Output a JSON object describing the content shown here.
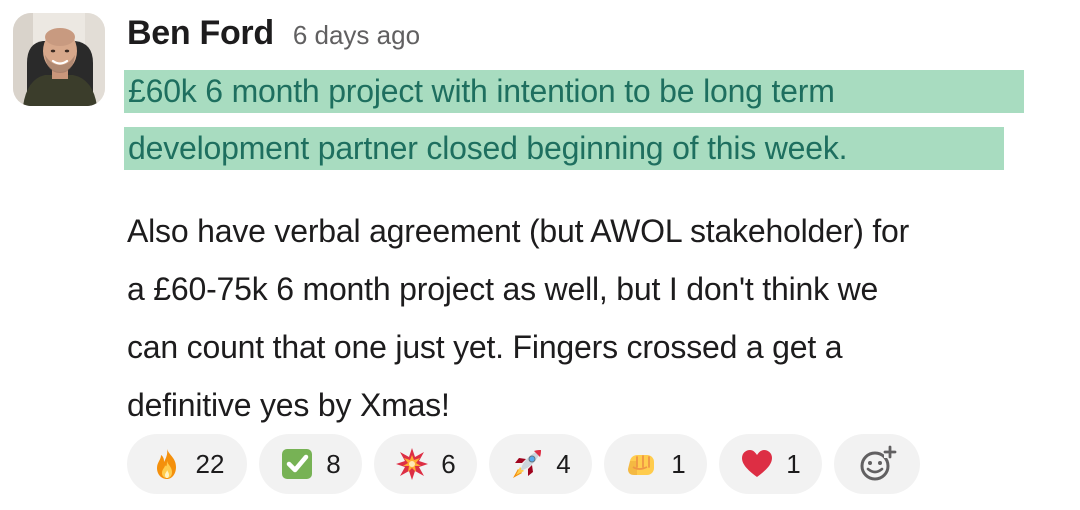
{
  "message": {
    "author": "Ben Ford",
    "timestamp": "6 days ago",
    "highlight_lines": [
      "£60k 6 month project with intention to be long term",
      "development partner closed beginning of this week."
    ],
    "body_lines": [
      "Also have verbal agreement (but AWOL stakeholder) for",
      "a £60-75k 6 month project as well, but I don't think we",
      "can count that one just yet. Fingers crossed a get a",
      "definitive yes by Xmas!"
    ]
  },
  "reactions": [
    {
      "emoji": "fire-icon",
      "count": "22"
    },
    {
      "emoji": "white-check-mark-icon",
      "count": "8"
    },
    {
      "emoji": "collision-icon",
      "count": "6"
    },
    {
      "emoji": "rocket-icon",
      "count": "4"
    },
    {
      "emoji": "punch-icon",
      "count": "1"
    },
    {
      "emoji": "heart-icon",
      "count": "1"
    }
  ],
  "add_reaction": {
    "icon": "add-reaction-icon"
  },
  "colors": {
    "highlight_bg": "#a8dcc0",
    "highlight_text": "#1e6f5f",
    "reaction_bg": "#f2f2f2",
    "timestamp": "#616061"
  }
}
